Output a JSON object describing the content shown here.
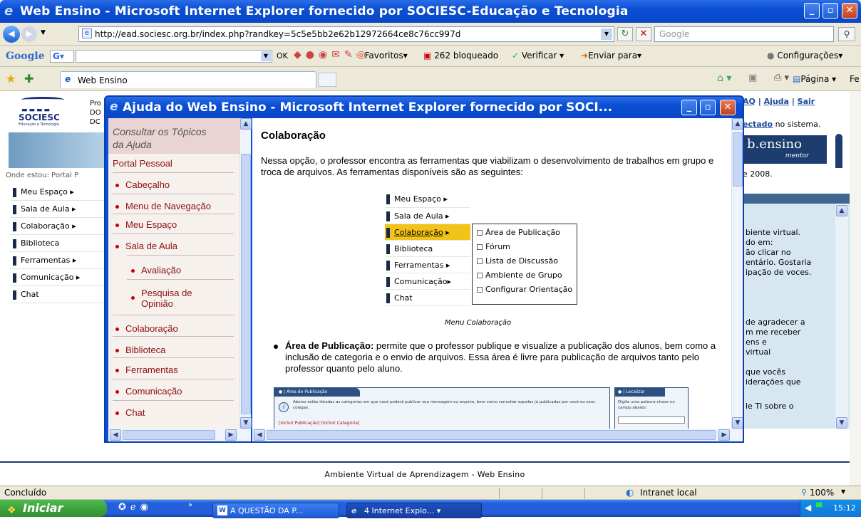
{
  "outer_window": {
    "title": "Web Ensino - Microsoft Internet Explorer fornecido por SOCIESC-Educação e Tecnologia",
    "address": "http://ead.sociesc.org.br/index.php?randkey=5c5e5bb2e62b12972664ce8c76cc997d",
    "search_placeholder": "Google",
    "google_toolbar": {
      "logo": "Google",
      "g_button": "G",
      "ok": "OK",
      "favoritos": "Favoritos",
      "bloqueado": "262 bloqueado",
      "verificar": "Verificar",
      "enviar": "Enviar para",
      "config": "Configurações"
    },
    "tab_label": "Web Ensino",
    "cmd": {
      "pagina": "Página",
      "ferramentas": "Ferramentas"
    }
  },
  "site": {
    "logo": "SOCIESC",
    "logo_sub": "Educação e Tecnologia",
    "header_cut": [
      "Pro",
      "DO",
      "DC"
    ],
    "breadcrumb": "Onde estou: Portal P",
    "menu": [
      "Meu Espaço",
      "Sala de Aula",
      "Colaboração",
      "Biblioteca",
      "Ferramentas",
      "Comunicação",
      "Chat"
    ],
    "menu_arrows": [
      true,
      true,
      true,
      false,
      true,
      true,
      false
    ],
    "top_links": [
      "AQ",
      "Ajuda",
      "Sair"
    ],
    "connected_link": "ectado",
    "connected_text": " no sistema.",
    "brand": "b.ensino",
    "brand_sub": "mentor",
    "date_cut": "e 2008.",
    "right_text": [
      "biente virtual.",
      "do em:",
      "ão clicar no",
      "entário. Gostaria",
      "ipação de voces.",
      "de agradecer a",
      "m me receber",
      "ens e",
      "virtual",
      "que vocês",
      "iderações que",
      "le TI sobre o"
    ],
    "footer": "Ambiente Virtual de Aprendizagem - Web Ensino"
  },
  "help_window": {
    "title": "Ajuda do Web Ensino - Microsoft Internet Explorer fornecido por SOCI...",
    "toc_header": "Consultar os Tópicos da Ajuda",
    "portal": "Portal Pessoal",
    "toc": [
      {
        "label": "Cabeçalho",
        "level": 1
      },
      {
        "label": "Menu de Navegação",
        "level": 1
      },
      {
        "label": "Meu Espaço",
        "level": 1
      },
      {
        "label": "Sala de Aula",
        "level": 1
      },
      {
        "label": "Avaliação",
        "level": 2
      },
      {
        "label": "Pesquisa de Opinião",
        "level": 2
      },
      {
        "label": "Colaboração",
        "level": 1
      },
      {
        "label": "Biblioteca",
        "level": 1
      },
      {
        "label": "Ferramentas",
        "level": 1
      },
      {
        "label": "Comunicação",
        "level": 1
      },
      {
        "label": "Chat",
        "level": 1
      }
    ],
    "content": {
      "heading": "Colaboração",
      "intro": "Nessa opção, o professor encontra as ferramentas que viabilizam o desenvolvimento de trabalhos em grupo e troca de arquivos. As ferramentas disponíveis são as seguintes:",
      "demo_menu": [
        "Meu Espaço",
        "Sala de Aula",
        "Colaboração",
        "Biblioteca",
        "Ferramentas",
        "Comunicação",
        "Chat"
      ],
      "demo_submenu": [
        "Área de Publicação",
        "Fórum",
        "Lista de Discussão",
        "Ambiente de Grupo",
        "Configurar Orientação"
      ],
      "caption": "Menu Colaboração",
      "bullet_title": "Área de Publicação:",
      "bullet_text": " permite que o professor publique e visualize a publicação dos alunos, bem como a inclusão de categoria e o envio de arquivos. Essa área é livre para publicação de arquivos tanto pelo professor quanto pelo aluno.",
      "shot_header": "Área de Publicação",
      "shot_text": "Abaixo estão listadas as categorias em que você poderá publicar sua mensagem ou arquivo, bem como consultar aquelas já publicadas por você ou seus colegas.",
      "shot_links": [
        "[Incluir Publicação]",
        "[Incluir Categoria]"
      ],
      "shot_side_header": "Localizar",
      "shot_side_text": "Digite uma palavra-chave no campo abaixo:"
    }
  },
  "status": {
    "left": "Concluído",
    "zone": "Intranet local",
    "zoom": "100%"
  },
  "taskbar": {
    "start": "Iniciar",
    "tasks": [
      "A QUESTÃO DA P...",
      "4 Internet Explo..."
    ],
    "clock": "15:12"
  }
}
